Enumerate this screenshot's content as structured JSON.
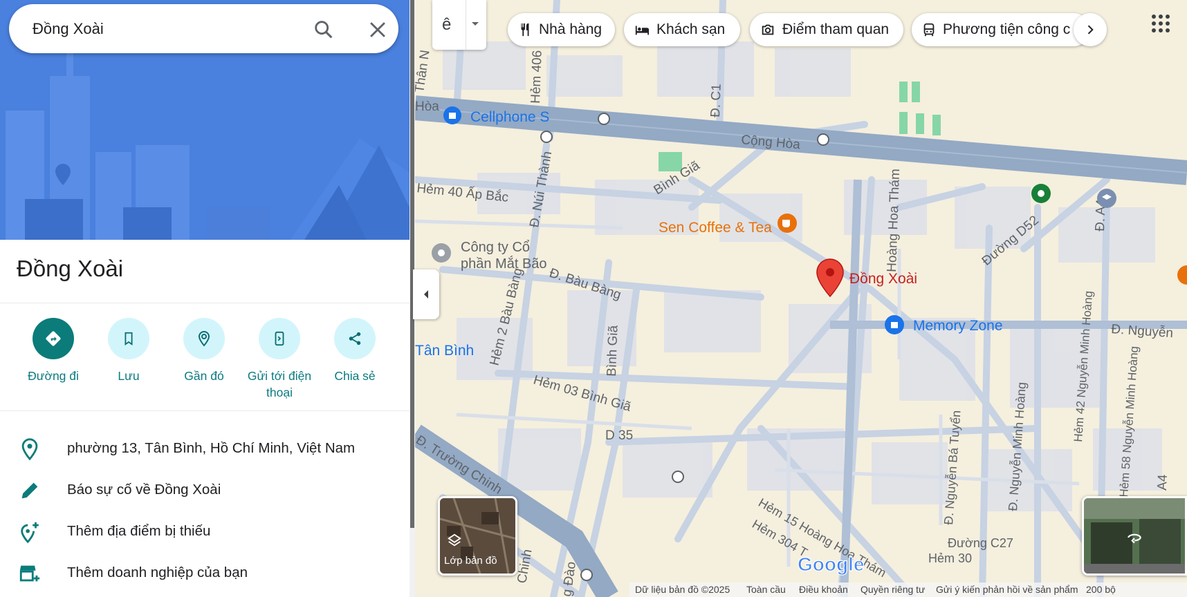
{
  "search": {
    "value": "Đồng Xoài"
  },
  "place": {
    "title": "Đồng Xoài"
  },
  "actions": [
    {
      "label": "Đường đi",
      "icon": "directions-icon"
    },
    {
      "label": "Lưu",
      "icon": "bookmark-icon"
    },
    {
      "label": "Gần đó",
      "icon": "nearby-icon"
    },
    {
      "label": "Gửi tới điện thoại",
      "icon": "send-to-phone-icon"
    },
    {
      "label": "Chia sẻ",
      "icon": "share-icon"
    }
  ],
  "info": {
    "address": "phường 13, Tân Bình, Hồ Chí Minh, Việt Nam",
    "report": "Báo sự cố về Đồng Xoài",
    "add_missing": "Thêm địa điểm bị thiếu",
    "add_business": "Thêm doanh nghiệp của bạn"
  },
  "map": {
    "lang_button": "ê",
    "chips": [
      {
        "label": "Nhà hàng",
        "icon": "restaurant-icon"
      },
      {
        "label": "Khách sạn",
        "icon": "hotel-icon"
      },
      {
        "label": "Điểm tham quan",
        "icon": "camera-icon"
      },
      {
        "label": "Phương tiện công c",
        "icon": "transit-icon"
      }
    ],
    "streets": {
      "cong_hoa": "Cộng Hòa",
      "hoa": "Hòa",
      "than_n": "Thân N",
      "hem_406": "Hẻm 406",
      "dc1": "Đ. C1",
      "binh_gia": "Bình Giã",
      "hem40": "Hẻm 40 Ấp Bắc",
      "nui_thanh": "Đ. Núi Thành",
      "bau_bang": "Đ. Bàu Bàng",
      "hem2": "Hẻm 2 Bàu Bàng",
      "binh_gia2": "Bình Giã",
      "hem03": "Hẻm 03 Bình Giã",
      "d35": "D 35",
      "truong_chinh": "Đ. Trường Chinh",
      "chinh": "Chinh",
      "dao": "g Đào",
      "hoang_hoa_tham": "Hoàng Hoa Thám",
      "duong_d52": "Đường D52",
      "da4": "Đ. A4",
      "nguyen": "Đ. Nguyễn",
      "hem42": "Hẻm 42 Nguyễn Minh Hoàng",
      "hem58": "Hẻm 58 Nguyễn Minh Hoàng",
      "nguyen_ba_tuyen": "Đ. Nguyễn Bá Tuyển",
      "nguyen_minh_hoang": "Đ. Nguyễn Minh Hoàng",
      "a4": "A4",
      "hem15": "Hẻm 15 Hoàng Hoa Thám",
      "hem304": "Hẻm 304 T",
      "c27": "Đường C27",
      "hem30": "Hẻm 30",
      "tan_binh": "Tân Bình"
    },
    "pois": {
      "cellphones": "Cellphone S",
      "sen": "Sen Coffee & Tea",
      "cong_ty_1": "Công ty Cổ",
      "cong_ty_2": "phần Mắt Bão",
      "memory": "Memory Zone",
      "dong_xoai": "Đồng Xoài"
    },
    "layer_label": "Lớp bản đồ",
    "google_logo": "Google",
    "footer": {
      "data": "Dữ liệu bản đồ ©2025",
      "global": "Toàn cầu",
      "terms": "Điều khoản",
      "privacy": "Quyền riêng tư",
      "feedback": "Gửi ý kiến phản hồi về sản phẩm",
      "scale": "200 bộ"
    }
  },
  "colors": {
    "accent": "#0b7c7a",
    "action_bg": "#d2f5fb",
    "hero_bg": "#4a80de",
    "road_major": "#93a9c4",
    "map_bg": "#f5efde",
    "pin": "#ea4335"
  }
}
